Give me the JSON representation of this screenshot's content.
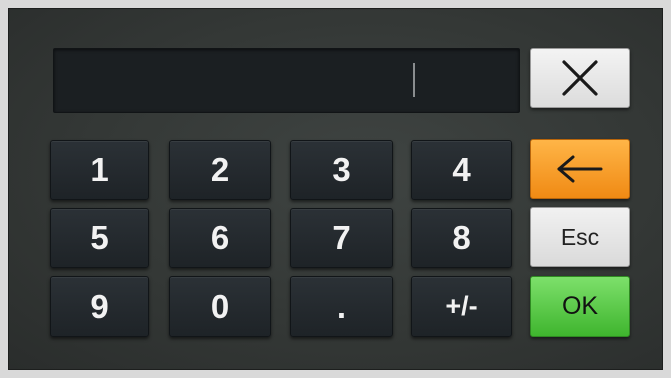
{
  "display": {
    "value": ""
  },
  "keypad": {
    "k1": "1",
    "k2": "2",
    "k3": "3",
    "k4": "4",
    "k5": "5",
    "k6": "6",
    "k7": "7",
    "k8": "8",
    "k9": "9",
    "k0": "0",
    "dot": ".",
    "sign": "+/-"
  },
  "actions": {
    "clear_icon": "close-icon",
    "backspace_icon": "arrow-left-icon",
    "esc_label": "Esc",
    "ok_label": "OK"
  },
  "colors": {
    "backspace": "#f39a1f",
    "ok": "#4cc83a",
    "key": "#232a2f"
  }
}
